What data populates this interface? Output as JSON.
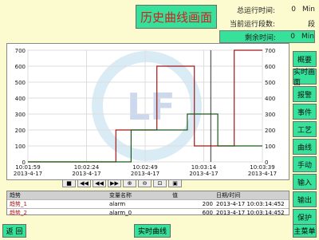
{
  "title": "历史曲线画面",
  "stats": [
    {
      "label": "总运行时间:",
      "value": "0",
      "unit": "Min"
    },
    {
      "label": "当前运行段数:",
      "value": "",
      "unit": "段"
    },
    {
      "label": "剩余时间:",
      "value": "0",
      "unit": "Min"
    }
  ],
  "chart_data": {
    "type": "line",
    "y_left_ticks": [
      "0",
      "100",
      "200",
      "300",
      "400",
      "500",
      "600",
      "700"
    ],
    "y_right_ticks": [
      "0",
      "100",
      "200",
      "300",
      "400",
      "500",
      "600",
      "700"
    ],
    "ylim": [
      0,
      700
    ],
    "x_ticks": [
      {
        "time": "10:01:59",
        "date": "2013-4-17"
      },
      {
        "time": "10:02:24",
        "date": "2013-4-17"
      },
      {
        "time": "10:02:49",
        "date": "2013-4-17"
      },
      {
        "time": "10:03:14",
        "date": "2013-4-17"
      },
      {
        "time": "10:03:39",
        "date": "2013-4-17"
      }
    ],
    "grid": true,
    "cursor_fraction": 0.78,
    "series": [
      {
        "color": "#a01818",
        "points": [
          [
            0,
            0
          ],
          [
            0.375,
            0
          ],
          [
            0.375,
            200
          ],
          [
            0.55,
            200
          ],
          [
            0.55,
            600
          ],
          [
            0.71,
            600
          ],
          [
            0.71,
            100
          ],
          [
            0.88,
            100
          ],
          [
            0.88,
            700
          ],
          [
            1,
            700
          ]
        ]
      },
      {
        "color": "#1c5a1c",
        "points": [
          [
            0,
            0
          ],
          [
            0.44,
            0
          ],
          [
            0.44,
            200
          ],
          [
            0.68,
            200
          ],
          [
            0.68,
            300
          ],
          [
            0.81,
            300
          ],
          [
            0.81,
            100
          ],
          [
            1,
            100
          ]
        ]
      }
    ]
  },
  "toolbar": [
    "■",
    "◀◀",
    "◀◀",
    "▶▶",
    "⊕",
    "⊖",
    "⊡",
    "▣"
  ],
  "table": {
    "headers": [
      "趋势",
      "变量名称",
      "值",
      "日期/时间"
    ],
    "rows": [
      {
        "trend": "趋势_1",
        "name": "alarm",
        "value": "200",
        "datetime": "2013-4-17 10:03:14:452",
        "color": "#a01818"
      },
      {
        "trend": "趋势_2",
        "name": "alarm_0",
        "value": "600",
        "datetime": "2013-4-17 10:03:14:452",
        "color": "#c01818"
      }
    ]
  },
  "sidebar": [
    "概要",
    "实时画面",
    "报警",
    "事件",
    "工艺",
    "曲线",
    "手动",
    "输入",
    "输出",
    "保护"
  ],
  "bottom": {
    "left": "返 回",
    "center": "实时曲线",
    "right": "主菜单"
  },
  "colors": {
    "accent": "#36e19a",
    "background": "#fbfbcf"
  }
}
